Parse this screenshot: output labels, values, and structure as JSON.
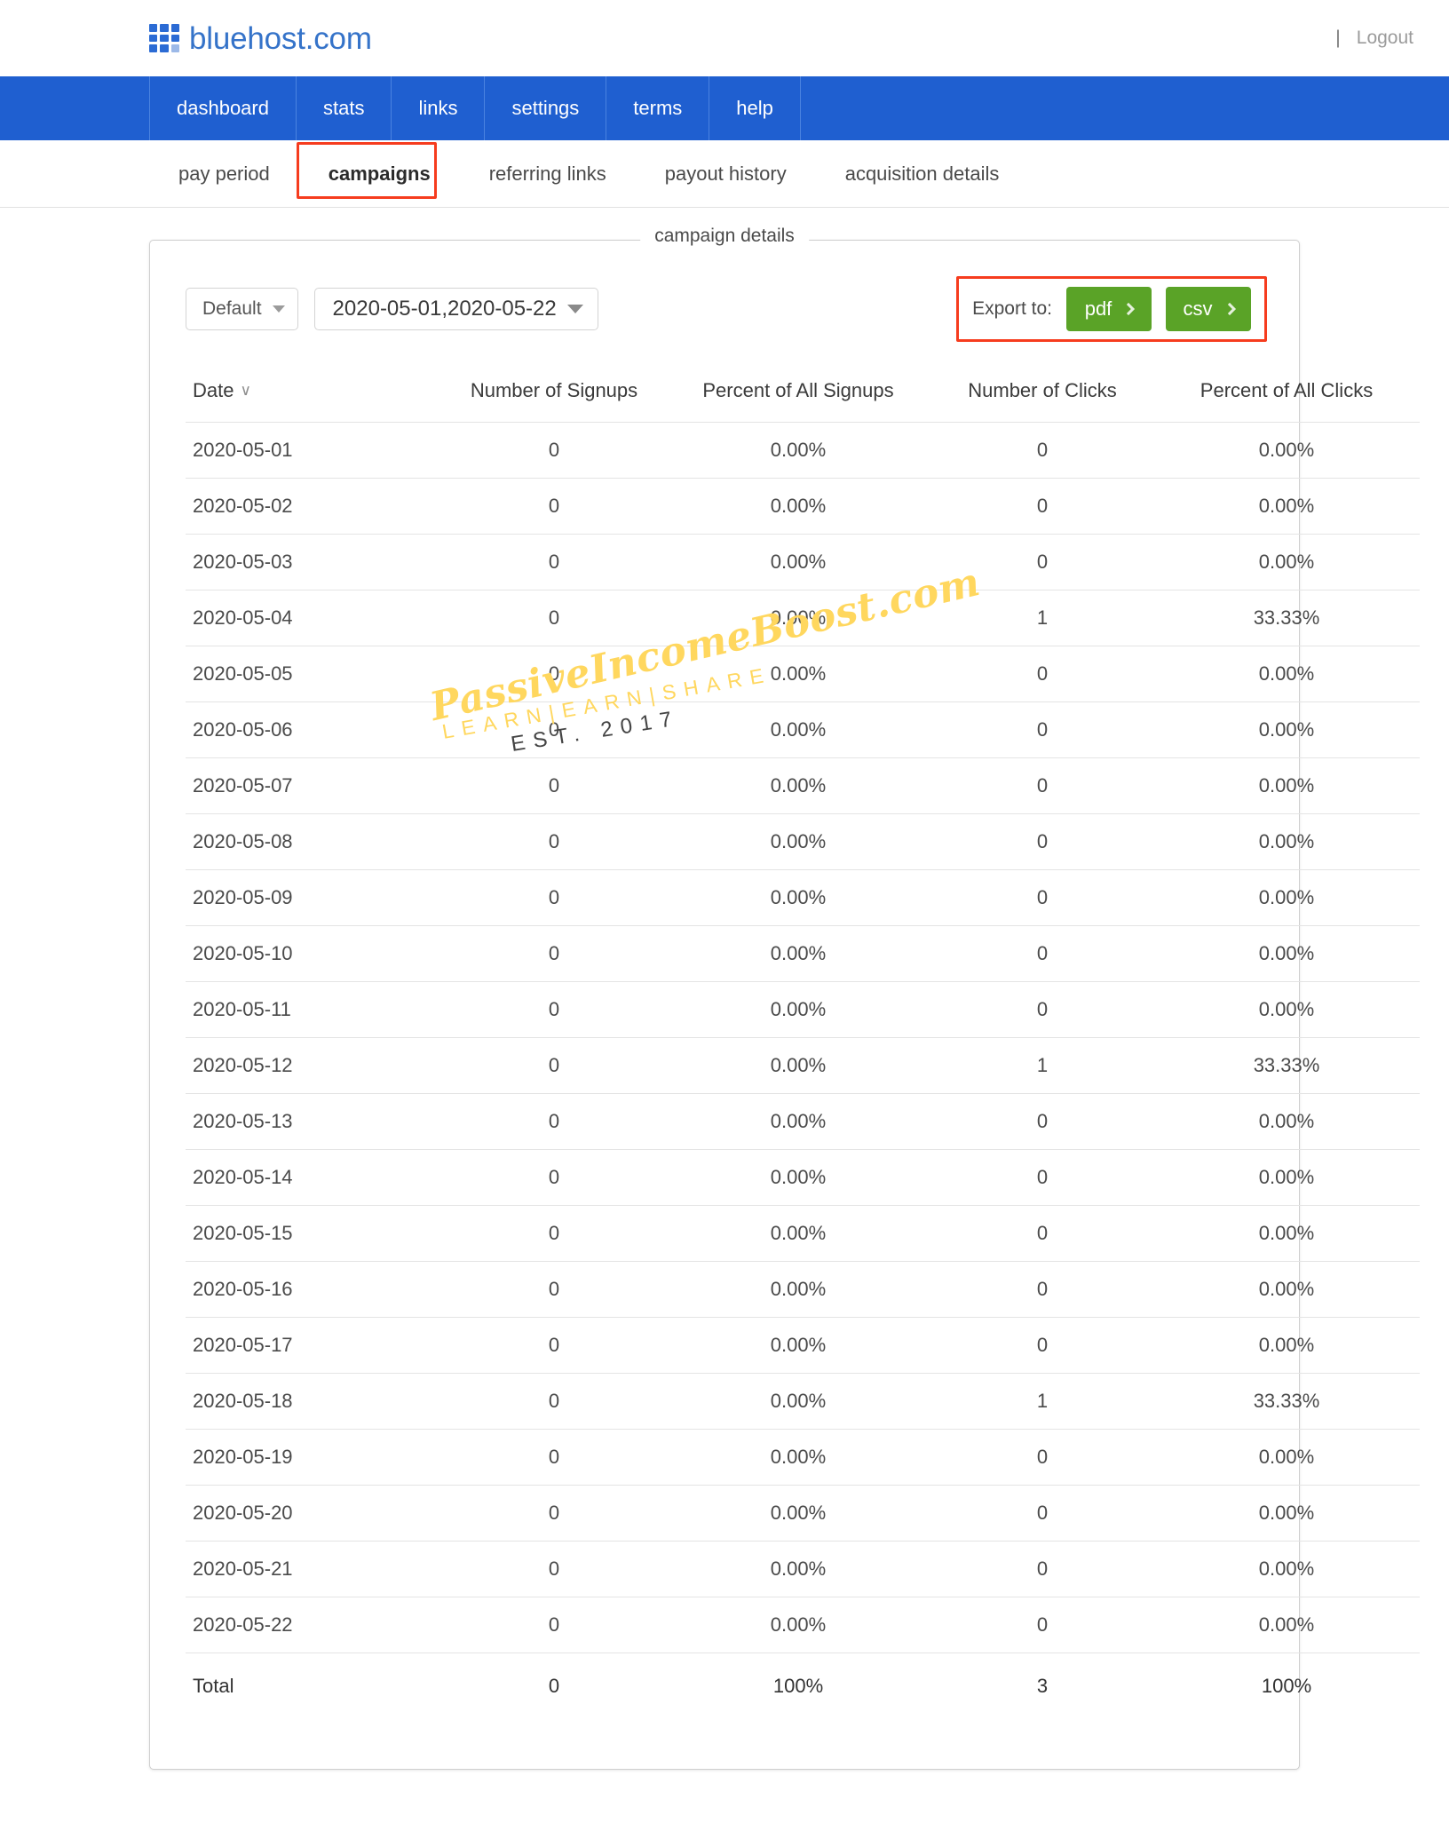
{
  "header": {
    "brand": "bluehost.com",
    "logo_icon": "grid-squares-icon",
    "divider": "|",
    "logout_label": "Logout"
  },
  "main_nav": {
    "items": [
      {
        "label": "dashboard",
        "name": "nav-dashboard"
      },
      {
        "label": "stats",
        "name": "nav-stats"
      },
      {
        "label": "links",
        "name": "nav-links"
      },
      {
        "label": "settings",
        "name": "nav-settings"
      },
      {
        "label": "terms",
        "name": "nav-terms"
      },
      {
        "label": "help",
        "name": "nav-help"
      }
    ]
  },
  "sub_nav": {
    "items": [
      {
        "label": "pay period",
        "active": false
      },
      {
        "label": "campaigns",
        "active": true
      },
      {
        "label": "referring links",
        "active": false
      },
      {
        "label": "payout history",
        "active": false
      },
      {
        "label": "acquisition details",
        "active": false
      }
    ],
    "highlight_color": "#f63c1e"
  },
  "panel": {
    "legend": "campaign details",
    "filter_select": {
      "value": "Default",
      "icon": "chevron-down-icon"
    },
    "date_range_select": {
      "value": "2020-05-01,2020-05-22",
      "icon": "chevron-down-icon"
    },
    "export": {
      "label": "Export to:",
      "buttons": [
        {
          "label": "pdf",
          "icon": "chevron-right-icon",
          "color": "#5aa327"
        },
        {
          "label": "csv",
          "icon": "chevron-right-icon",
          "color": "#5aa327"
        }
      ],
      "highlight_color": "#f63c1e"
    }
  },
  "table": {
    "columns": [
      "Date",
      "Number of Signups",
      "Percent of All Signups",
      "Number of Clicks",
      "Percent of All Clicks"
    ],
    "sort_column": "Date",
    "sort_icon": "chevron-down-icon",
    "rows": [
      {
        "date": "2020-05-01",
        "signups": "0",
        "pct_signups": "0.00%",
        "clicks": "0",
        "pct_clicks": "0.00%"
      },
      {
        "date": "2020-05-02",
        "signups": "0",
        "pct_signups": "0.00%",
        "clicks": "0",
        "pct_clicks": "0.00%"
      },
      {
        "date": "2020-05-03",
        "signups": "0",
        "pct_signups": "0.00%",
        "clicks": "0",
        "pct_clicks": "0.00%"
      },
      {
        "date": "2020-05-04",
        "signups": "0",
        "pct_signups": "0.00%",
        "clicks": "1",
        "pct_clicks": "33.33%"
      },
      {
        "date": "2020-05-05",
        "signups": "0",
        "pct_signups": "0.00%",
        "clicks": "0",
        "pct_clicks": "0.00%"
      },
      {
        "date": "2020-05-06",
        "signups": "0",
        "pct_signups": "0.00%",
        "clicks": "0",
        "pct_clicks": "0.00%"
      },
      {
        "date": "2020-05-07",
        "signups": "0",
        "pct_signups": "0.00%",
        "clicks": "0",
        "pct_clicks": "0.00%"
      },
      {
        "date": "2020-05-08",
        "signups": "0",
        "pct_signups": "0.00%",
        "clicks": "0",
        "pct_clicks": "0.00%"
      },
      {
        "date": "2020-05-09",
        "signups": "0",
        "pct_signups": "0.00%",
        "clicks": "0",
        "pct_clicks": "0.00%"
      },
      {
        "date": "2020-05-10",
        "signups": "0",
        "pct_signups": "0.00%",
        "clicks": "0",
        "pct_clicks": "0.00%"
      },
      {
        "date": "2020-05-11",
        "signups": "0",
        "pct_signups": "0.00%",
        "clicks": "0",
        "pct_clicks": "0.00%"
      },
      {
        "date": "2020-05-12",
        "signups": "0",
        "pct_signups": "0.00%",
        "clicks": "1",
        "pct_clicks": "33.33%"
      },
      {
        "date": "2020-05-13",
        "signups": "0",
        "pct_signups": "0.00%",
        "clicks": "0",
        "pct_clicks": "0.00%"
      },
      {
        "date": "2020-05-14",
        "signups": "0",
        "pct_signups": "0.00%",
        "clicks": "0",
        "pct_clicks": "0.00%"
      },
      {
        "date": "2020-05-15",
        "signups": "0",
        "pct_signups": "0.00%",
        "clicks": "0",
        "pct_clicks": "0.00%"
      },
      {
        "date": "2020-05-16",
        "signups": "0",
        "pct_signups": "0.00%",
        "clicks": "0",
        "pct_clicks": "0.00%"
      },
      {
        "date": "2020-05-17",
        "signups": "0",
        "pct_signups": "0.00%",
        "clicks": "0",
        "pct_clicks": "0.00%"
      },
      {
        "date": "2020-05-18",
        "signups": "0",
        "pct_signups": "0.00%",
        "clicks": "1",
        "pct_clicks": "33.33%"
      },
      {
        "date": "2020-05-19",
        "signups": "0",
        "pct_signups": "0.00%",
        "clicks": "0",
        "pct_clicks": "0.00%"
      },
      {
        "date": "2020-05-20",
        "signups": "0",
        "pct_signups": "0.00%",
        "clicks": "0",
        "pct_clicks": "0.00%"
      },
      {
        "date": "2020-05-21",
        "signups": "0",
        "pct_signups": "0.00%",
        "clicks": "0",
        "pct_clicks": "0.00%"
      },
      {
        "date": "2020-05-22",
        "signups": "0",
        "pct_signups": "0.00%",
        "clicks": "0",
        "pct_clicks": "0.00%"
      }
    ],
    "total_row": {
      "date": "Total",
      "signups": "0",
      "pct_signups": "100%",
      "clicks": "3",
      "pct_clicks": "100%"
    }
  },
  "watermark": {
    "line1": "PassiveIncomeBoost.com",
    "line2": "LEARN|EARN|SHARE",
    "line3": "EST. 2017",
    "color": "#ffd75e"
  },
  "colors": {
    "brand_blue": "#3573c9",
    "nav_blue": "#1f5fd0",
    "green": "#5aa327",
    "highlight_red": "#f63c1e"
  }
}
